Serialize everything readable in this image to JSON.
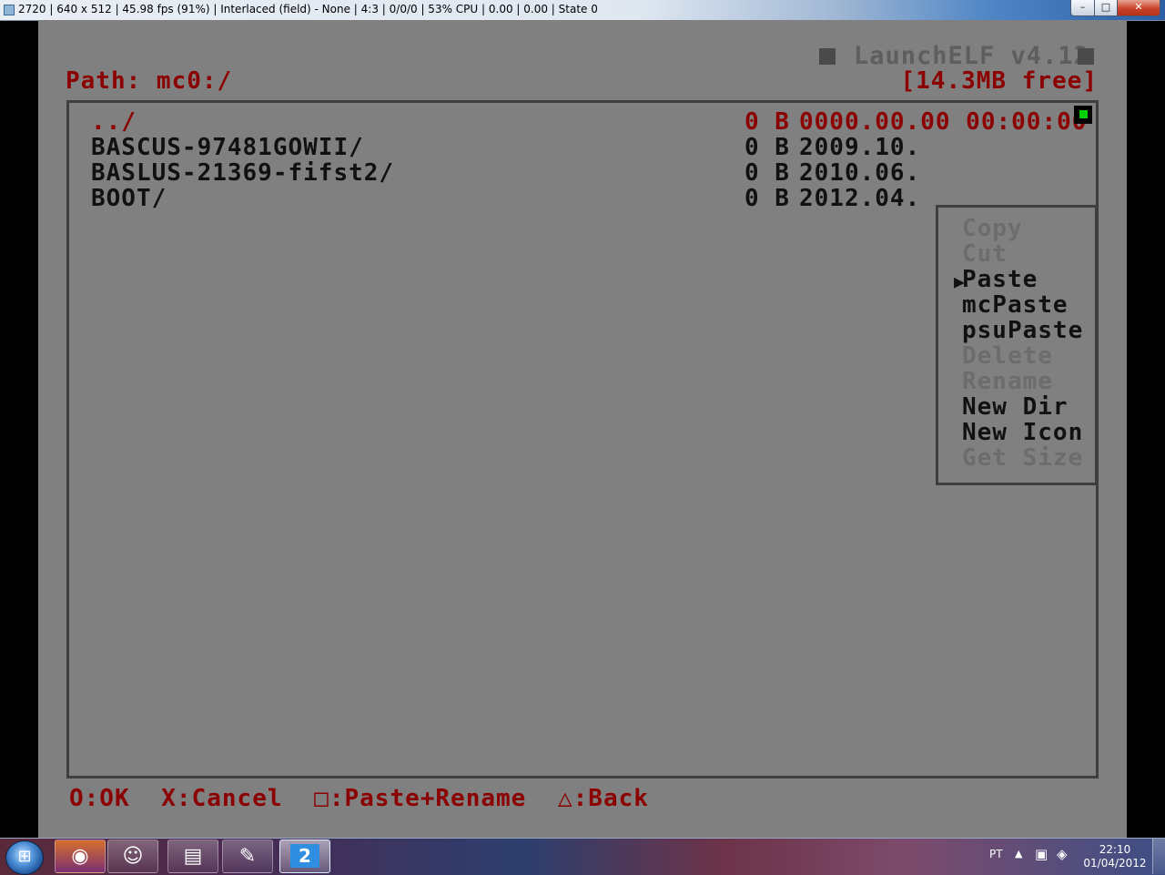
{
  "window": {
    "title": "2720 | 640 x 512 | 45.98 fps (91%) | Interlaced (field) - None | 4:3 | 0/0/0 | 53% CPU | 0.00 | 0.00 | State 0",
    "minimize_glyph": "–",
    "maximize_glyph": "□",
    "close_glyph": "✕"
  },
  "header": {
    "title": "LaunchELF v4.12",
    "path": "Path: mc0:/",
    "free": "[14.3MB free]"
  },
  "files": [
    {
      "name": "../",
      "size": "0 B",
      "date": "0000.00.00 00:00:00"
    },
    {
      "name": "BASCUS-97481GOWII/",
      "size": "0 B",
      "date": "2009.10."
    },
    {
      "name": "BASLUS-21369-fifst2/",
      "size": "0 B",
      "date": "2010.06."
    },
    {
      "name": "BOOT/",
      "size": "0 B",
      "date": "2012.04."
    }
  ],
  "menu": {
    "items": [
      {
        "label": "Copy",
        "enabled": false
      },
      {
        "label": "Cut",
        "enabled": false
      },
      {
        "label": "Paste",
        "enabled": true,
        "selected": true
      },
      {
        "label": "mcPaste",
        "enabled": true
      },
      {
        "label": "psuPaste",
        "enabled": true
      },
      {
        "label": "Delete",
        "enabled": false
      },
      {
        "label": "Rename",
        "enabled": false
      },
      {
        "label": "New Dir",
        "enabled": true
      },
      {
        "label": "New Icon",
        "enabled": true
      },
      {
        "label": "Get Size",
        "enabled": false
      }
    ],
    "cursor_glyph": "▶"
  },
  "hints": {
    "ok": "O:OK",
    "cancel": "X:Cancel",
    "paste_rename": "□:Paste+Rename",
    "back": "△:Back"
  },
  "taskbar": {
    "start_glyph": "⊞",
    "apps": [
      {
        "icon": "firefox-icon",
        "glyph": "◉"
      },
      {
        "icon": "messenger-icon",
        "glyph": "☺"
      },
      {
        "icon": "explorer-icon",
        "glyph": "▤"
      },
      {
        "icon": "paint-icon",
        "glyph": "✎"
      },
      {
        "icon": "pcsx2-icon",
        "glyph": "2"
      }
    ],
    "tray": {
      "language": "PT",
      "arrow_glyph": "▲",
      "network_glyph": "▣",
      "volume_glyph": "◈",
      "time": "22:10",
      "date": "01/04/2012"
    }
  },
  "colors": {
    "screen_bg": "#808080",
    "header_red": "#8b0000",
    "text_dark": "#111111",
    "disabled_gray": "#6c6c6c",
    "selection_green": "#00d000"
  }
}
